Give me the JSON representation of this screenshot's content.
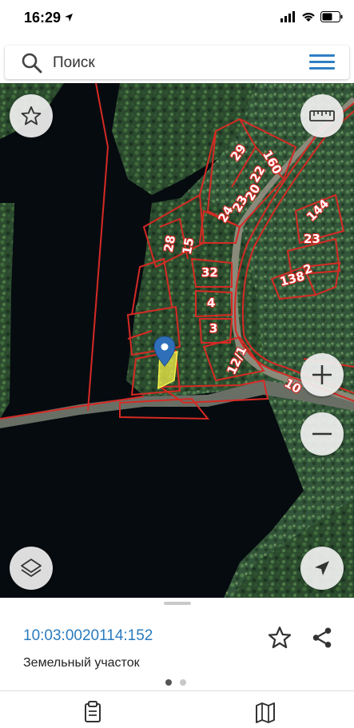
{
  "status_bar": {
    "time": "16:29"
  },
  "search": {
    "placeholder": "Поиск"
  },
  "map": {
    "parcel_labels": [
      "29",
      "160",
      "22",
      "20",
      "23",
      "24",
      "144",
      "23",
      "2",
      "138",
      "28",
      "15",
      "32",
      "4",
      "3",
      "12/1",
      "10"
    ],
    "boundary_color": "#d62a24",
    "selected_parcel_color": "#f3f04a",
    "marker_color": "#2f6fba"
  },
  "object": {
    "cadastral_number": "10:03:0020114:152",
    "type": "Земельный участок"
  },
  "pager": {
    "pages": 2,
    "current": 1
  },
  "tabs": [
    {
      "icon": "clipboard-icon"
    },
    {
      "icon": "map-icon"
    }
  ]
}
